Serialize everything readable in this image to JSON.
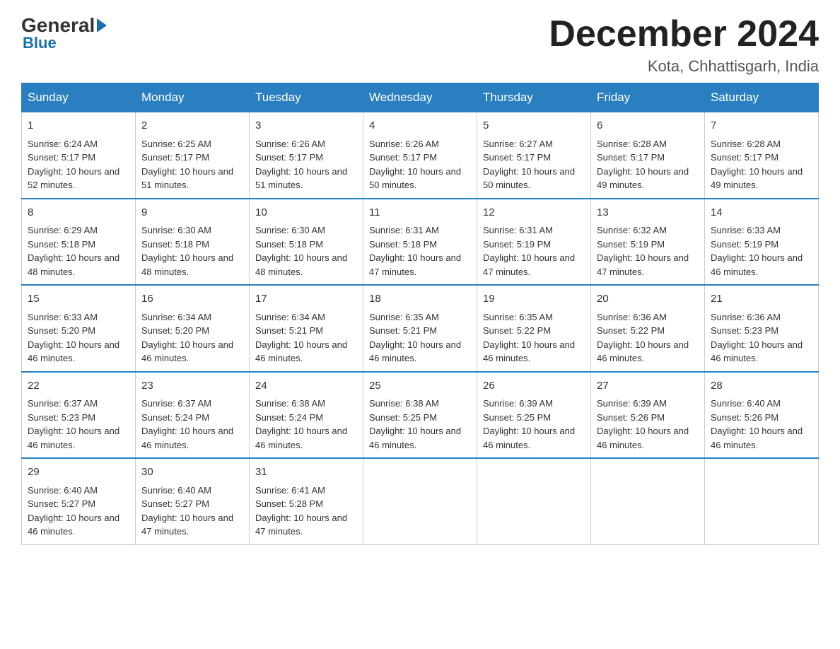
{
  "header": {
    "logo_general": "General",
    "logo_blue": "Blue",
    "month_year": "December 2024",
    "location": "Kota, Chhattisgarh, India"
  },
  "days_of_week": [
    "Sunday",
    "Monday",
    "Tuesday",
    "Wednesday",
    "Thursday",
    "Friday",
    "Saturday"
  ],
  "weeks": [
    [
      {
        "num": "1",
        "sunrise": "6:24 AM",
        "sunset": "5:17 PM",
        "daylight": "10 hours and 52 minutes."
      },
      {
        "num": "2",
        "sunrise": "6:25 AM",
        "sunset": "5:17 PM",
        "daylight": "10 hours and 51 minutes."
      },
      {
        "num": "3",
        "sunrise": "6:26 AM",
        "sunset": "5:17 PM",
        "daylight": "10 hours and 51 minutes."
      },
      {
        "num": "4",
        "sunrise": "6:26 AM",
        "sunset": "5:17 PM",
        "daylight": "10 hours and 50 minutes."
      },
      {
        "num": "5",
        "sunrise": "6:27 AM",
        "sunset": "5:17 PM",
        "daylight": "10 hours and 50 minutes."
      },
      {
        "num": "6",
        "sunrise": "6:28 AM",
        "sunset": "5:17 PM",
        "daylight": "10 hours and 49 minutes."
      },
      {
        "num": "7",
        "sunrise": "6:28 AM",
        "sunset": "5:17 PM",
        "daylight": "10 hours and 49 minutes."
      }
    ],
    [
      {
        "num": "8",
        "sunrise": "6:29 AM",
        "sunset": "5:18 PM",
        "daylight": "10 hours and 48 minutes."
      },
      {
        "num": "9",
        "sunrise": "6:30 AM",
        "sunset": "5:18 PM",
        "daylight": "10 hours and 48 minutes."
      },
      {
        "num": "10",
        "sunrise": "6:30 AM",
        "sunset": "5:18 PM",
        "daylight": "10 hours and 48 minutes."
      },
      {
        "num": "11",
        "sunrise": "6:31 AM",
        "sunset": "5:18 PM",
        "daylight": "10 hours and 47 minutes."
      },
      {
        "num": "12",
        "sunrise": "6:31 AM",
        "sunset": "5:19 PM",
        "daylight": "10 hours and 47 minutes."
      },
      {
        "num": "13",
        "sunrise": "6:32 AM",
        "sunset": "5:19 PM",
        "daylight": "10 hours and 47 minutes."
      },
      {
        "num": "14",
        "sunrise": "6:33 AM",
        "sunset": "5:19 PM",
        "daylight": "10 hours and 46 minutes."
      }
    ],
    [
      {
        "num": "15",
        "sunrise": "6:33 AM",
        "sunset": "5:20 PM",
        "daylight": "10 hours and 46 minutes."
      },
      {
        "num": "16",
        "sunrise": "6:34 AM",
        "sunset": "5:20 PM",
        "daylight": "10 hours and 46 minutes."
      },
      {
        "num": "17",
        "sunrise": "6:34 AM",
        "sunset": "5:21 PM",
        "daylight": "10 hours and 46 minutes."
      },
      {
        "num": "18",
        "sunrise": "6:35 AM",
        "sunset": "5:21 PM",
        "daylight": "10 hours and 46 minutes."
      },
      {
        "num": "19",
        "sunrise": "6:35 AM",
        "sunset": "5:22 PM",
        "daylight": "10 hours and 46 minutes."
      },
      {
        "num": "20",
        "sunrise": "6:36 AM",
        "sunset": "5:22 PM",
        "daylight": "10 hours and 46 minutes."
      },
      {
        "num": "21",
        "sunrise": "6:36 AM",
        "sunset": "5:23 PM",
        "daylight": "10 hours and 46 minutes."
      }
    ],
    [
      {
        "num": "22",
        "sunrise": "6:37 AM",
        "sunset": "5:23 PM",
        "daylight": "10 hours and 46 minutes."
      },
      {
        "num": "23",
        "sunrise": "6:37 AM",
        "sunset": "5:24 PM",
        "daylight": "10 hours and 46 minutes."
      },
      {
        "num": "24",
        "sunrise": "6:38 AM",
        "sunset": "5:24 PM",
        "daylight": "10 hours and 46 minutes."
      },
      {
        "num": "25",
        "sunrise": "6:38 AM",
        "sunset": "5:25 PM",
        "daylight": "10 hours and 46 minutes."
      },
      {
        "num": "26",
        "sunrise": "6:39 AM",
        "sunset": "5:25 PM",
        "daylight": "10 hours and 46 minutes."
      },
      {
        "num": "27",
        "sunrise": "6:39 AM",
        "sunset": "5:26 PM",
        "daylight": "10 hours and 46 minutes."
      },
      {
        "num": "28",
        "sunrise": "6:40 AM",
        "sunset": "5:26 PM",
        "daylight": "10 hours and 46 minutes."
      }
    ],
    [
      {
        "num": "29",
        "sunrise": "6:40 AM",
        "sunset": "5:27 PM",
        "daylight": "10 hours and 46 minutes."
      },
      {
        "num": "30",
        "sunrise": "6:40 AM",
        "sunset": "5:27 PM",
        "daylight": "10 hours and 47 minutes."
      },
      {
        "num": "31",
        "sunrise": "6:41 AM",
        "sunset": "5:28 PM",
        "daylight": "10 hours and 47 minutes."
      },
      null,
      null,
      null,
      null
    ]
  ]
}
